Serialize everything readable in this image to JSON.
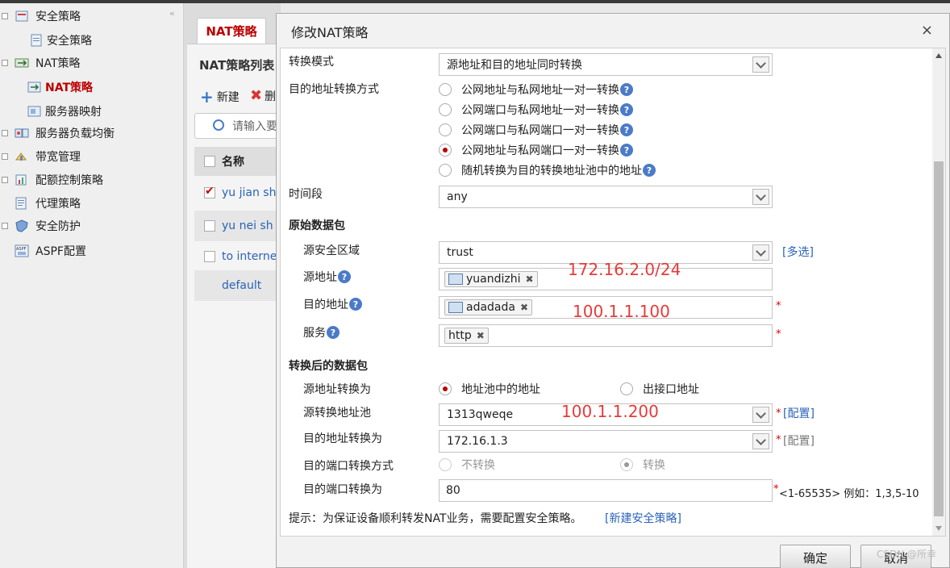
{
  "sidebar": {
    "items": [
      {
        "label": "安全策略",
        "icon": "shield-policy-icon"
      },
      {
        "label": "安全策略",
        "icon": "policy-doc-icon"
      },
      {
        "label": "NAT策略",
        "icon": "nat-icon"
      },
      {
        "label": "NAT策略",
        "icon": "nat-policy-icon"
      },
      {
        "label": "服务器映射",
        "icon": "server-map-icon"
      },
      {
        "label": "服务器负载均衡",
        "icon": "load-balance-icon"
      },
      {
        "label": "带宽管理",
        "icon": "bandwidth-icon"
      },
      {
        "label": "配额控制策略",
        "icon": "quota-icon"
      },
      {
        "label": "代理策略",
        "icon": "proxy-icon"
      },
      {
        "label": "安全防护",
        "icon": "defense-icon"
      },
      {
        "label": "ASPF配置",
        "icon": "aspf-icon"
      }
    ]
  },
  "list": {
    "tab": "NAT策略",
    "title": "NAT策略列表",
    "new_label": "新建",
    "delete_label": "删",
    "search_placeholder": "请输入要",
    "col_name": "名称",
    "rows": [
      "yu jian sh",
      "yu  nei  sh",
      "to internet",
      "default"
    ]
  },
  "dialog": {
    "title": "修改NAT策略",
    "close": "×",
    "mode_label": "转换模式",
    "mode_value": "源地址和目的地址同时转换",
    "dst_method_label": "目的地址转换方式",
    "dst_methods": [
      "公网地址与私网地址一对一转换",
      "公网端口与私网地址一对一转换",
      "公网端口与私网端口一对一转换",
      "公网地址与私网端口一对一转换",
      "随机转换为目的转换地址池中的地址"
    ],
    "time_label": "时间段",
    "time_value": "any",
    "orig_section": "原始数据包",
    "src_zone_label": "源安全区域",
    "src_zone_value": "trust",
    "multi_select": "[多选]",
    "src_addr_label": "源地址",
    "src_addr_tag": "yuandizhi",
    "dst_addr_label": "目的地址",
    "dst_addr_tag": "adadada",
    "service_label": "服务",
    "service_tag": "http",
    "after_section": "转换后的数据包",
    "src_translate_label": "源地址转换为",
    "src_opt_pool": "地址池中的地址",
    "src_opt_iface": "出接口地址",
    "src_pool_label": "源转换地址池",
    "src_pool_value": "1313qweqe",
    "config_link": "[配置]",
    "dst_translate_label": "目的地址转换为",
    "dst_translate_value": "172.16.1.3",
    "config_link_gray": "[配置]",
    "dst_port_method_label": "目的端口转换方式",
    "port_opt_none": "不转换",
    "port_opt_translate": "转换",
    "dst_port_label": "目的端口转换为",
    "dst_port_value": "80",
    "port_hint": "<1-65535> 例如：1,3,5-10",
    "tip": "提示：为保证设备顺利转发NAT业务，需要配置安全策略。",
    "new_policy_link": "[新建安全策略]",
    "ok": "确定",
    "cancel": "取消",
    "required_mark": "*",
    "help_mark": "?"
  },
  "annotations": {
    "src": "172.16.2.0/24",
    "dst": "100.1.1.100",
    "pool": "100.1.1.200"
  },
  "watermark": "CSDN @所幸"
}
